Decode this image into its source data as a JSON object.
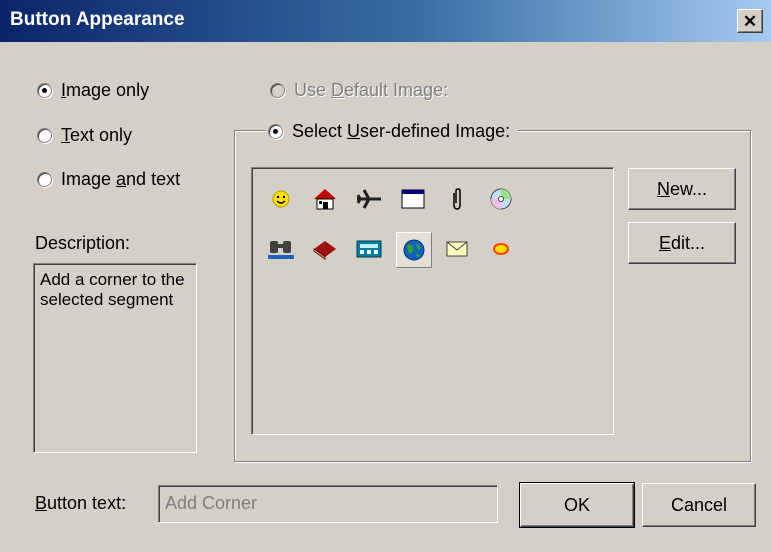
{
  "window": {
    "title": "Button Appearance",
    "close_glyph": "✕"
  },
  "display_options": [
    {
      "label_pre": "",
      "accel": "I",
      "label_post": "mage only",
      "checked": true
    },
    {
      "label_pre": "",
      "accel": "T",
      "label_post": "ext only",
      "checked": false
    },
    {
      "label_pre": "Image ",
      "accel": "a",
      "label_post": "nd text",
      "checked": false
    }
  ],
  "image_source": {
    "default_pre": "Use ",
    "default_accel": "D",
    "default_post": "efault Image:",
    "user_pre": "Select ",
    "user_accel": "U",
    "user_post": "ser-defined Image:"
  },
  "description": {
    "label": "Description:",
    "text": "Add a corner to the selected segment"
  },
  "icons": [
    {
      "name": "smiley-icon"
    },
    {
      "name": "house-icon"
    },
    {
      "name": "airplane-icon"
    },
    {
      "name": "window-icon"
    },
    {
      "name": "paperclip-icon"
    },
    {
      "name": "cd-icon"
    },
    {
      "name": "binoculars-icon"
    },
    {
      "name": "book-icon"
    },
    {
      "name": "calculator-icon"
    },
    {
      "name": "globe-icon",
      "selected": true
    },
    {
      "name": "envelope-icon"
    },
    {
      "name": "shape-icon"
    }
  ],
  "buttons": {
    "new_accel": "N",
    "new_post": "ew...",
    "edit_accel": "E",
    "edit_post": "dit...",
    "ok": "OK",
    "cancel": "Cancel"
  },
  "button_text": {
    "label_accel": "B",
    "label_post": "utton text:",
    "value": "Add Corner"
  },
  "colors": {
    "title_start": "#0a246a",
    "title_end": "#a6caf0",
    "face": "#d4d0c8"
  }
}
